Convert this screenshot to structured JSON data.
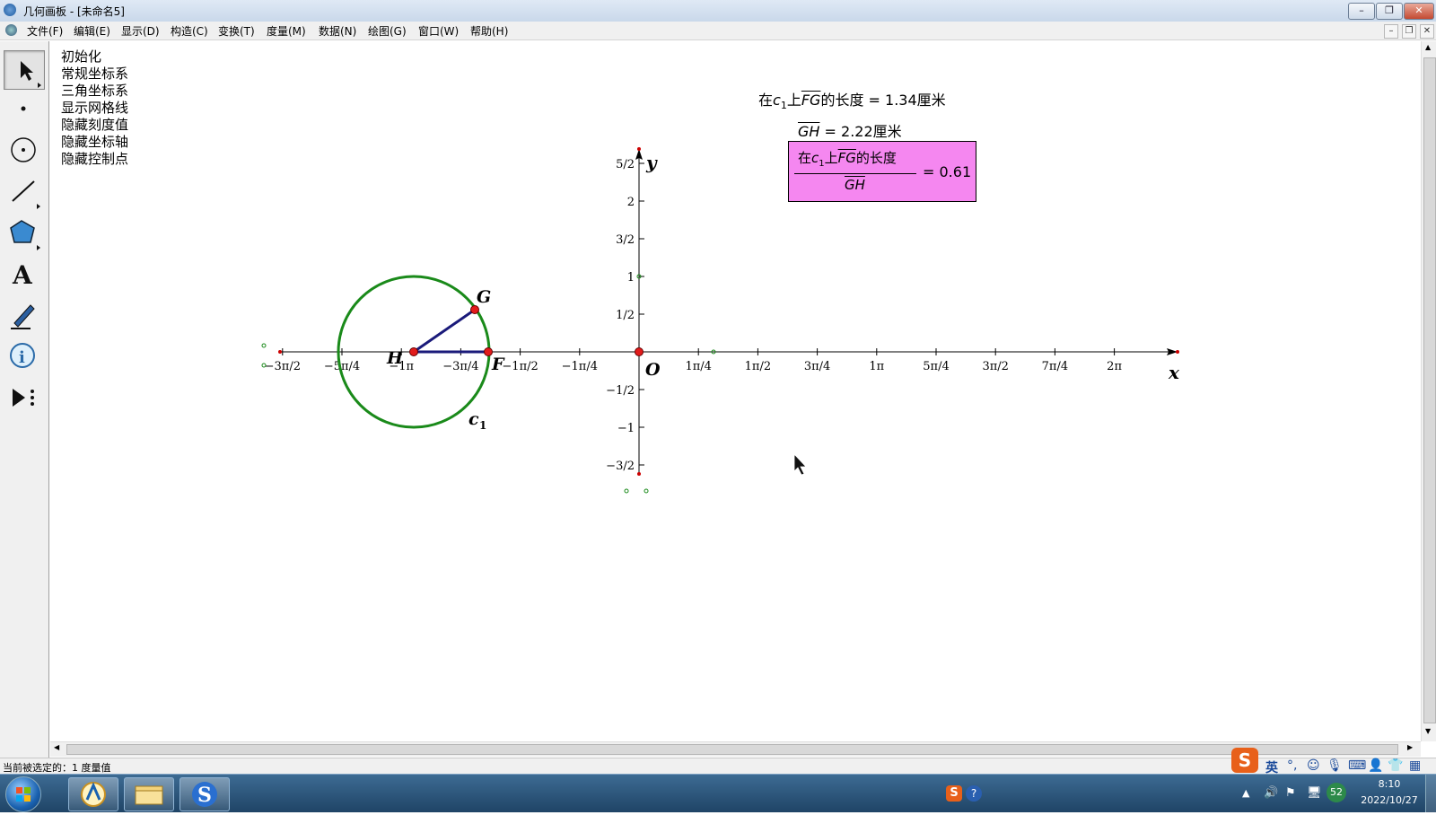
{
  "window": {
    "title": "几何画板 - [未命名5]"
  },
  "menu": [
    "文件(F)",
    "编辑(E)",
    "显示(D)",
    "构造(C)",
    "变换(T)",
    "度量(M)",
    "数据(N)",
    "绘图(G)",
    "窗口(W)",
    "帮助(H)"
  ],
  "commands": [
    "初始化",
    "常规坐标系",
    "三角坐标系",
    "显示网格线",
    "隐藏刻度值",
    "隐藏坐标轴",
    "隐藏控制点"
  ],
  "measurements": {
    "arc_prefix": "在",
    "arc_c": "c",
    "arc_sub": "1",
    "arc_on": "上",
    "arc_fg": "FG",
    "arc_suffix": "的长度 = 1.34厘米",
    "gh_seg": "GH",
    "gh_value": " = 2.22厘米",
    "ratio_value": "= 0.61",
    "ratio_num_suffix": "的长度"
  },
  "graph": {
    "x_ticks": [
      "−3π/2",
      "−5π/4",
      "−1π",
      "−3π/4",
      "−1π/2",
      "−1π/4",
      "1π/4",
      "1π/2",
      "3π/4",
      "1π",
      "5π/4",
      "3π/2",
      "7π/4",
      "2π"
    ],
    "y_ticks": [
      "5/2",
      "2",
      "3/2",
      "1",
      "1/2",
      "−1/2",
      "−1",
      "−3/2"
    ],
    "axis_x": "x",
    "axis_y": "y",
    "origin": "O",
    "point_g": "G",
    "point_h": "H",
    "point_f": "F",
    "circle_label": "c",
    "circle_sub": "1",
    "colors": {
      "circle": "#1a8a1a",
      "segment": "#1a1a7a",
      "point": "#e21b1b",
      "ratio_fill": "#f587f0"
    }
  },
  "status": "当前被选定的：1 度量值",
  "tray": {
    "time": "8:10",
    "date": "2022/10/27",
    "ime": "英",
    "badge": "52"
  },
  "icons": [
    "select-arrow-icon",
    "point-icon",
    "compass-icon",
    "line-icon",
    "polygon-icon",
    "text-icon",
    "marker-icon",
    "info-icon",
    "custom-tool-icon"
  ]
}
